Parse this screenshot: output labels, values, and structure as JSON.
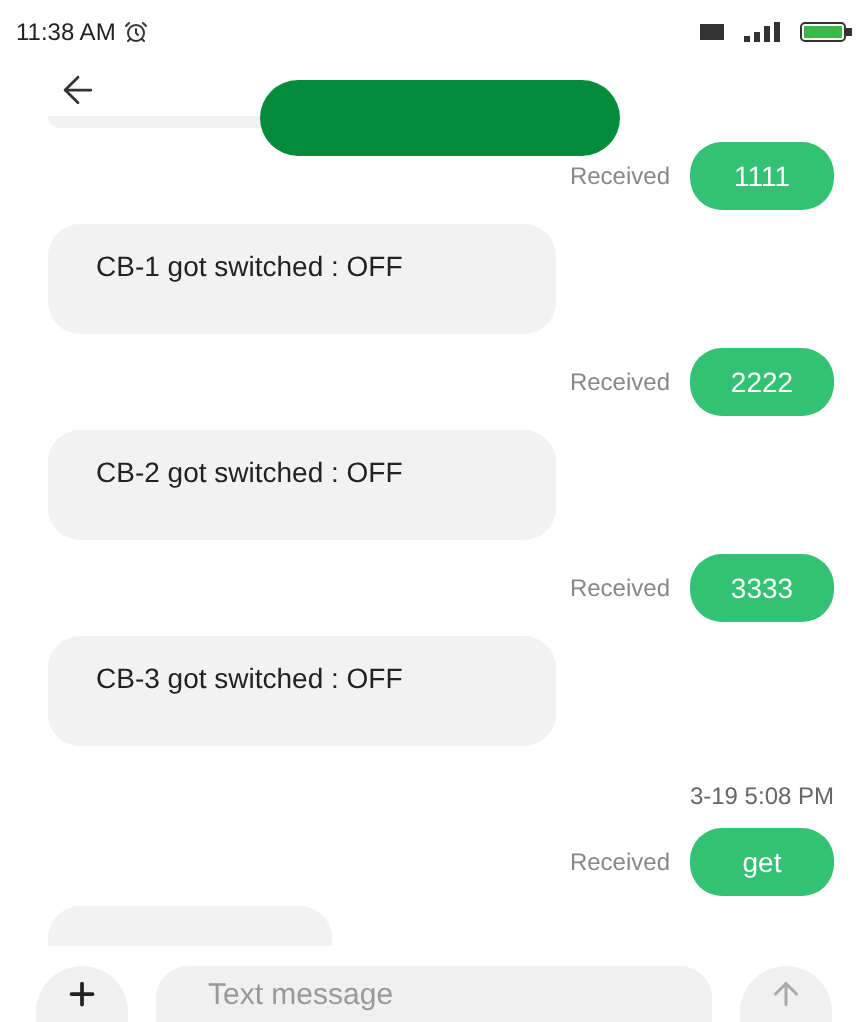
{
  "status_bar": {
    "time": "11:38 AM"
  },
  "messages": [
    {
      "kind": "incoming"
    },
    {
      "kind": "outgoing",
      "status": "Received",
      "text": "1111"
    },
    {
      "kind": "incoming",
      "text": "CB-1 got switched : OFF"
    },
    {
      "kind": "outgoing",
      "status": "Received",
      "text": "2222"
    },
    {
      "kind": "incoming",
      "text": "CB-2 got switched : OFF"
    },
    {
      "kind": "outgoing",
      "status": "Received",
      "text": "3333"
    },
    {
      "kind": "incoming",
      "text": "CB-3 got switched : OFF"
    },
    {
      "kind": "timestamp",
      "text": "3-19 5:08 PM"
    },
    {
      "kind": "outgoing",
      "status": "Received",
      "text": "get"
    },
    {
      "kind": "incoming"
    }
  ],
  "composer": {
    "placeholder": "Text message"
  }
}
